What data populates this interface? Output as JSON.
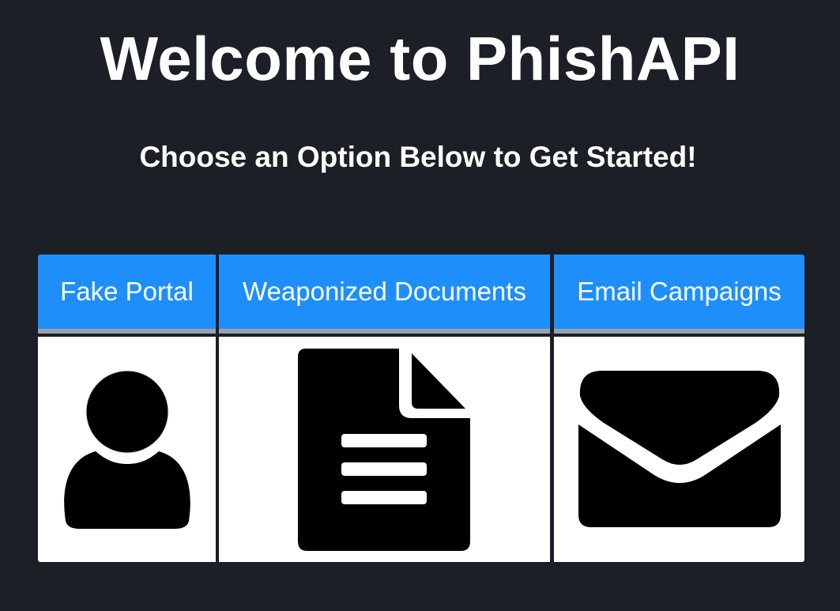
{
  "page": {
    "title": "Welcome to PhishAPI",
    "subtitle": "Choose an Option Below to Get Started!"
  },
  "options": [
    {
      "label": "Fake Portal",
      "icon": "user-icon"
    },
    {
      "label": "Weaponized Documents",
      "icon": "document-icon"
    },
    {
      "label": "Email Campaigns",
      "icon": "envelope-icon"
    }
  ],
  "colors": {
    "background": "#1c1f26",
    "accent": "#1e8ffa",
    "header_border": "#9aa0a8",
    "card_body": "#ffffff",
    "icon": "#000000"
  }
}
